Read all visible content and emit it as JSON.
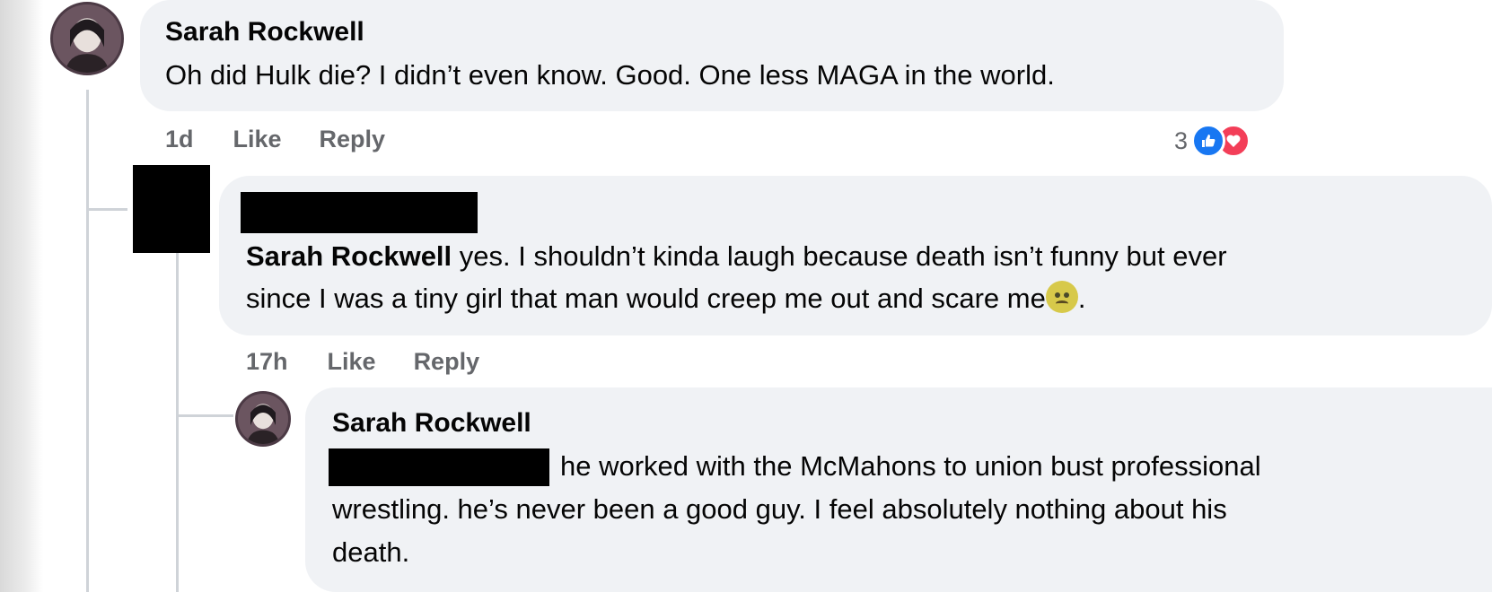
{
  "comments": [
    {
      "author": "Sarah Rockwell",
      "text": "Oh did Hulk die? I didn’t even know. Good. One less MAGA in the world.",
      "time": "1d",
      "like_label": "Like",
      "reply_label": "Reply",
      "reaction_count": "3",
      "reactions": [
        "like-icon",
        "love-icon"
      ]
    },
    {
      "author": "",
      "author_redacted": true,
      "mention": "Sarah Rockwell",
      "text_line1": " yes. I shouldn’t kinda laugh because death isn’t funny but ever",
      "text_line2": "since I was a tiny girl that man would creep me out and scare me",
      "text_end": ".",
      "emoji": "nauseated-face-emoji",
      "time": "17h",
      "like_label": "Like",
      "reply_label": "Reply"
    },
    {
      "author": "Sarah Rockwell",
      "mention_redacted": true,
      "text_line1": "he worked with the McMahons to union bust professional",
      "text_line2": "wrestling. he’s never been a good guy. I feel absolutely nothing about his",
      "text_line3": "death."
    }
  ],
  "colors": {
    "bubble": "#f0f2f5",
    "meta_text": "#65676b",
    "like_blue": "#1877f2",
    "love_red": "#f33e58"
  }
}
